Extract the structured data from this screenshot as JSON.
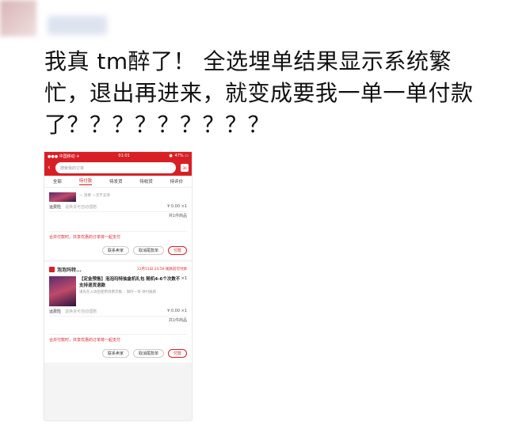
{
  "post": {
    "text": "我真 tm醉了！ 全选埋单结果显示系统繁忙，退出再进来，就变成要我一单一单付款了？？？？？？？？？"
  },
  "phone": {
    "status": {
      "carrier": "●●● 中国移动 ✈",
      "time": "01:01",
      "battery": "⏰ 47% ▭"
    },
    "search": {
      "placeholder": "搜索我的订单",
      "badge": "30"
    },
    "tabs": [
      "全部",
      "待付款",
      "待发货",
      "待收货",
      "待评价"
    ],
    "order1": {
      "note_top": "一 消费 一次不支持",
      "shipping_label": "运费险",
      "shipping_note": "退换货可自动理赔",
      "price": "¥ 0.00 ×1",
      "summary": "共1件商品",
      "pay_note": "合并付款时，共享优惠的订单将一起支付",
      "buttons": {
        "contact": "联系卖家",
        "cancel": "取消尾款单",
        "pay": "付款"
      }
    },
    "order2": {
      "shop_name": "泡泡玛特...",
      "status": "11月11日 23:59 尾款前可付款",
      "item_title": "【定金预售】泡泡玛特抽盒机礼包 随机4-6个次数不支持退货退款",
      "item_note": "请先在入场后使用消费次数... 限时一单 待付尾款",
      "item_qty": "×1",
      "shipping_label": "运费险",
      "shipping_note": "退换货可自动理赔",
      "price": "¥ 0.00 ×1",
      "summary": "共1件商品",
      "pay_note": "合并付款时，共享优惠的订单将一起支付",
      "buttons": {
        "contact": "联系卖家",
        "cancel": "取消尾款单",
        "pay": "付款"
      }
    }
  },
  "colors": {
    "accent": "#d81f26"
  }
}
